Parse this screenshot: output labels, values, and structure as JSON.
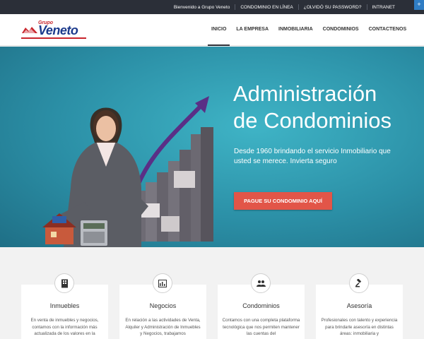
{
  "topbar": {
    "links": [
      "Bienvenido a Grupo Veneto",
      "CONDOMINIO EN LÍNEA",
      "¿OLVIDÓ SU PASSWORD?",
      "INTRANET"
    ],
    "corner_icon": "plus-icon"
  },
  "header": {
    "logo": {
      "grupo": "Grupo",
      "name": "Veneto"
    },
    "nav": [
      "INICIO",
      "LA EMPRESA",
      "INMOBILIARIA",
      "CONDOMINIOS",
      "CONTACTENOS"
    ],
    "active_nav": "INICIO"
  },
  "hero": {
    "title_line1": "Administración",
    "title_line2": "de Condominios",
    "subtitle": "Desde 1960 brindando el servicio Inmobiliario que usted se merece. Invierta seguro",
    "cta_label": "PAGUE SU CONDOMINIO AQUÍ",
    "colors": {
      "accent": "#e25548",
      "bg": "#2b8fa6"
    }
  },
  "services": [
    {
      "title": "Inmuebles",
      "icon": "building-icon",
      "text": "En venta de inmuebles y negocios, contamos con la información más actualizada de los valores en la"
    },
    {
      "title": "Negocios",
      "icon": "bar-chart-icon",
      "text": "En relación a las actividades de Venta, Alquiler y Administración de Inmuebles y Negocios, trabajamos"
    },
    {
      "title": "Condominios",
      "icon": "users-icon",
      "text": "Contamos con una completa plataforma tecnológica que nos permiten mantener las cuentas del"
    },
    {
      "title": "Asesoría",
      "icon": "gavel-icon",
      "text": "Profesionales con talento y experiencia para brindarle asesoría en distintas áreas: inmobiliaria y"
    }
  ]
}
